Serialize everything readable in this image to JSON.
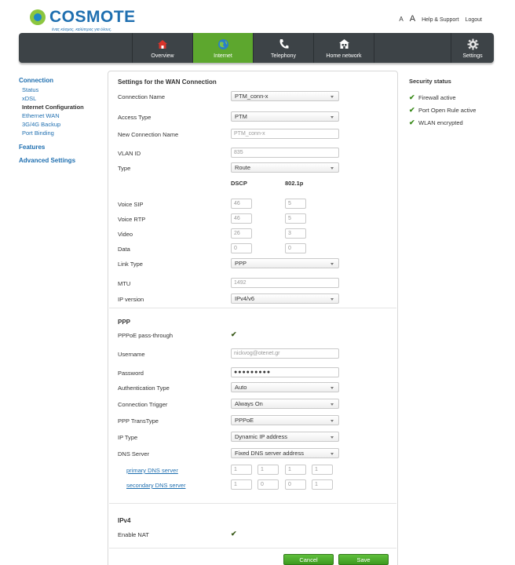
{
  "header": {
    "brand": "COSMOTE",
    "tagline": "ένας κόσμος, καλύτερος για όλους.",
    "font_small": "A",
    "font_large": "A",
    "help_link": "Help & Support",
    "logout_link": "Logout"
  },
  "nav": {
    "items": [
      {
        "label": "Overview",
        "icon": "house-icon"
      },
      {
        "label": "Internet",
        "icon": "globe-icon"
      },
      {
        "label": "Telephony",
        "icon": "phone-icon"
      },
      {
        "label": "Home network",
        "icon": "home-network-icon"
      },
      {
        "label": "Settings",
        "icon": "gear-icon"
      }
    ],
    "active": "Internet",
    "active_color": "#5da72e",
    "bar_color": "#3d4347"
  },
  "sidebar": {
    "connection": "Connection",
    "status": "Status",
    "xdsl": "xDSL",
    "internet_configuration": "Internet Configuration",
    "ethernet_wan": "Ethernet WAN",
    "backup": "3G/4G Backup",
    "port_binding": "Port Binding",
    "features": "Features",
    "advanced": "Advanced Settings"
  },
  "security": {
    "title": "Security status",
    "items": [
      "Firewall active",
      "Port Open Rule active",
      "WLAN encrypted"
    ]
  },
  "form": {
    "title": "Settings for the WAN Connection",
    "connection_name": {
      "label": "Connection Name",
      "value": "PTM_conn-x"
    },
    "access_type": {
      "label": "Access Type",
      "value": "PTM"
    },
    "new_connection_name": {
      "label": "New Connection Name",
      "placeholder": "PTM_conn-x"
    },
    "vlan_id": {
      "label": "VLAN ID",
      "value": "835"
    },
    "type": {
      "label": "Type",
      "value": "Route"
    },
    "dscp_header": "DSCP",
    "p8021_header": "802.1p",
    "voice_sip": {
      "label": "Voice SIP",
      "dscp": "46",
      "p": "5"
    },
    "voice_rtp": {
      "label": "Voice RTP",
      "dscp": "46",
      "p": "5"
    },
    "video": {
      "label": "Video",
      "dscp": "26",
      "p": "3"
    },
    "data": {
      "label": "Data",
      "dscp": "0",
      "p": "0"
    },
    "link_type": {
      "label": "Link Type",
      "value": "PPP"
    },
    "mtu": {
      "label": "MTU",
      "value": "1492"
    },
    "ip_version": {
      "label": "IP version",
      "value": "IPv4/v6"
    },
    "ppp_title": "PPP",
    "pppoe_passthrough": {
      "label": "PPPoE pass-through",
      "checked": true
    },
    "username": {
      "label": "Username",
      "value": "nickvog@otenet.gr"
    },
    "password": {
      "label": "Password",
      "value": "●●●●●●●●●"
    },
    "auth_type": {
      "label": "Authentication Type",
      "value": "Auto"
    },
    "conn_trigger": {
      "label": "Connection Trigger",
      "value": "Always On"
    },
    "ppp_transtype": {
      "label": "PPP TransType",
      "value": "PPPoE"
    },
    "ip_type": {
      "label": "IP Type",
      "value": "Dynamic IP address"
    },
    "dns_server": {
      "label": "DNS Server",
      "value": "Fixed DNS server address"
    },
    "primary_dns": {
      "label": "primary DNS server",
      "octets": [
        "1",
        "1",
        "1",
        "1"
      ]
    },
    "secondary_dns": {
      "label": "secondary DNS server",
      "octets": [
        "1",
        "0",
        "0",
        "1"
      ]
    },
    "ipv4_title": "IPv4",
    "enable_nat": {
      "label": "Enable NAT",
      "checked": true
    },
    "cancel": "Cancel",
    "save": "Save"
  }
}
